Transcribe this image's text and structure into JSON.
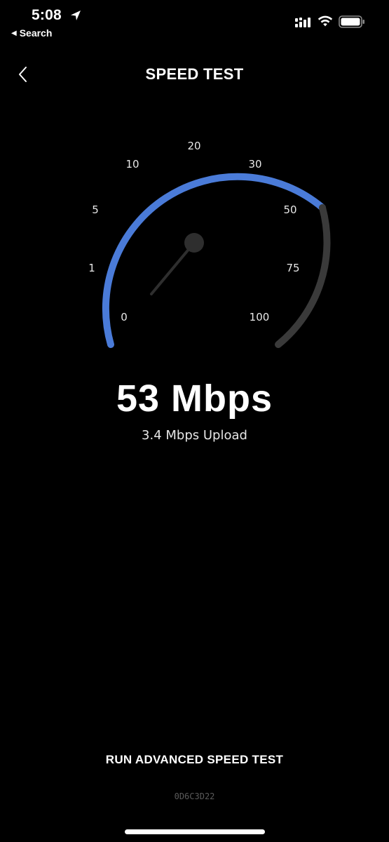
{
  "status_bar": {
    "time": "5:08",
    "back_label": "Search",
    "icons": [
      "location-arrow-icon",
      "cellular-signal-icon",
      "wifi-icon",
      "battery-icon"
    ]
  },
  "nav": {
    "title": "SPEED TEST",
    "back_icon": "chevron-left-icon"
  },
  "gauge": {
    "ticks": [
      "0",
      "1",
      "5",
      "10",
      "20",
      "30",
      "50",
      "75",
      "100"
    ],
    "current_speed_mbps": 53,
    "accent_color": "#4a7bd8",
    "track_color": "#3a3a3a",
    "needle_color": "#2e2e2e"
  },
  "result": {
    "download": "53 Mbps",
    "upload": "3.4 Mbps Upload"
  },
  "footer": {
    "advanced_button": "RUN ADVANCED SPEED TEST",
    "device_code": "0D6C3D22"
  }
}
